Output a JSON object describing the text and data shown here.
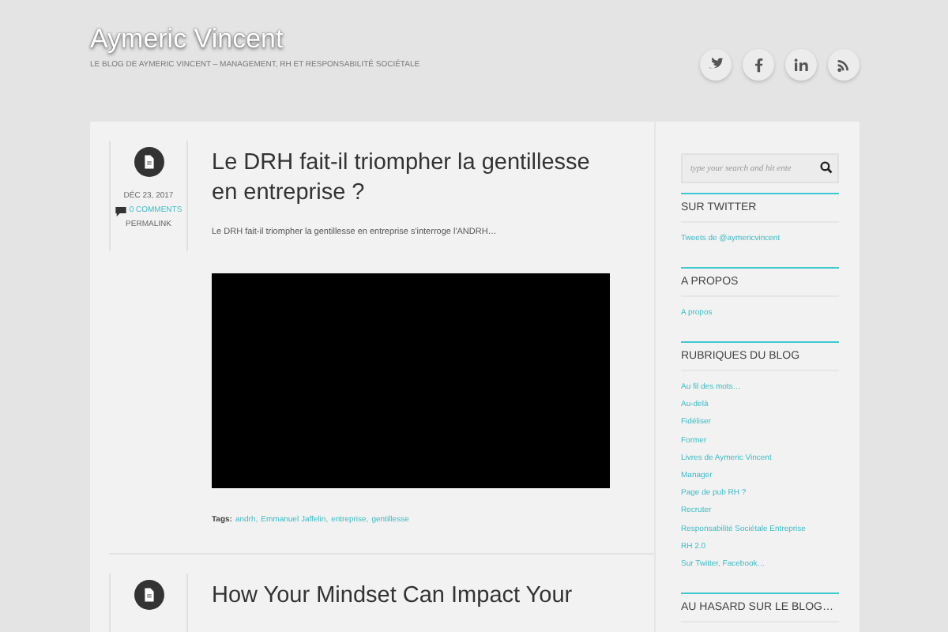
{
  "site": {
    "title": "Aymeric Vincent",
    "tagline": "LE BLOG DE AYMERIC VINCENT – MANAGEMENT, RH ET RESPONSABILITÉ SOCIÉTALE"
  },
  "social": [
    {
      "kind": "twitter"
    },
    {
      "kind": "facebook"
    },
    {
      "kind": "linkedin"
    },
    {
      "kind": "rss"
    }
  ],
  "posts": [
    {
      "title": "Le DRH fait-il triompher la gentillesse en entreprise ?",
      "date": "DÉC 23, 2017",
      "comments": "0 COMMENTS",
      "permalink": "PERMALINK",
      "excerpt": "Le DRH fait-il triompher la gentillesse en entreprise s'interroge l'ANDRH…",
      "media": {
        "kind": "video"
      },
      "tags_label": "Tags:",
      "tags": [
        "andrh,",
        "Emmanuel Jaffelin,",
        "entreprise,",
        "gentillesse"
      ]
    },
    {
      "title": "How Your Mindset Can Impact Your"
    }
  ],
  "sidebar": {
    "search": {
      "placeholder": "type your search and hit ente"
    },
    "widgets": [
      {
        "title": "SUR TWITTER",
        "links": [
          "Tweets de @aymericvincent"
        ]
      },
      {
        "title": "A PROPOS",
        "links": [
          "A propos"
        ]
      },
      {
        "title": "RUBRIQUES DU BLOG",
        "links": [
          "Au fil des mots…",
          "Au-delà",
          "Fidéliser",
          "Former",
          "Livres de Aymeric Vincent",
          "Manager",
          "Page de pub RH ?",
          "Recruter",
          "Responsabilité Sociétale Entreprise",
          "RH 2.0",
          "Sur Twitter, Facebook…"
        ]
      },
      {
        "title": "AU HASARD SUR LE BLOG…"
      }
    ]
  }
}
